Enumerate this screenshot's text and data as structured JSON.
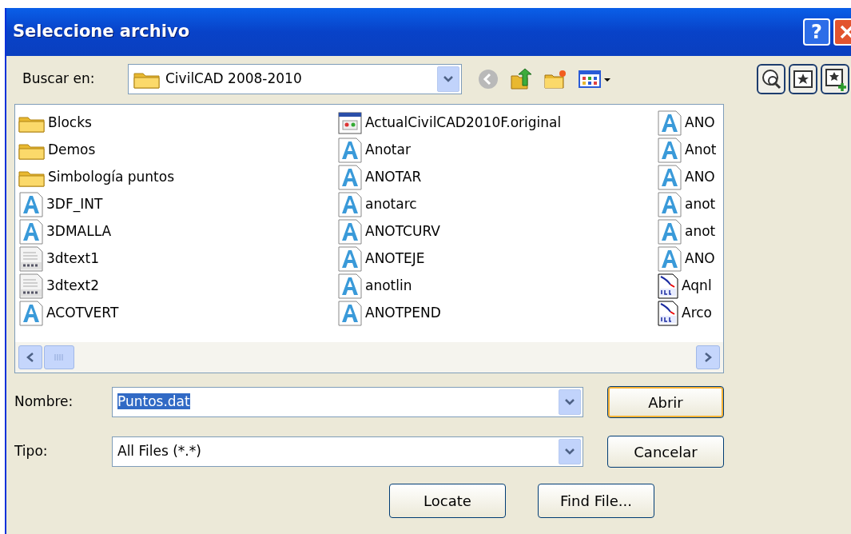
{
  "window": {
    "title": "Seleccione archivo",
    "help": "?"
  },
  "look_in": {
    "label": "Buscar en:",
    "value": "CivilCAD 2008-2010"
  },
  "toolbar": {
    "back_disabled": true
  },
  "file_list": {
    "columns": [
      [
        {
          "kind": "folder",
          "name": "Blocks"
        },
        {
          "kind": "folder",
          "name": "Demos"
        },
        {
          "kind": "folder",
          "name": "Simbología puntos"
        },
        {
          "kind": "font",
          "name": "3DF_INT"
        },
        {
          "kind": "font",
          "name": "3DMALLA"
        },
        {
          "kind": "shx",
          "name": "3dtext1"
        },
        {
          "kind": "shx",
          "name": "3dtext2"
        },
        {
          "kind": "font",
          "name": "ACOTVERT"
        }
      ],
      [
        {
          "kind": "app",
          "name": "ActualCivilCAD2010F.original"
        },
        {
          "kind": "font",
          "name": "Anotar"
        },
        {
          "kind": "font",
          "name": "ANOTAR"
        },
        {
          "kind": "font",
          "name": "anotarc"
        },
        {
          "kind": "font",
          "name": "ANOTCURV"
        },
        {
          "kind": "font",
          "name": "ANOTEJE"
        },
        {
          "kind": "font",
          "name": "anotlin"
        },
        {
          "kind": "font",
          "name": "ANOTPEND"
        }
      ],
      [
        {
          "kind": "font",
          "name": "ANO"
        },
        {
          "kind": "font",
          "name": "Anot"
        },
        {
          "kind": "font",
          "name": "ANO"
        },
        {
          "kind": "font",
          "name": "anot"
        },
        {
          "kind": "font",
          "name": "anot"
        },
        {
          "kind": "font",
          "name": "ANO"
        },
        {
          "kind": "slb",
          "name": "Aqnl"
        },
        {
          "kind": "slb",
          "name": "Arco"
        }
      ]
    ]
  },
  "file_name": {
    "label": "Nombre:",
    "value": "Puntos.dat",
    "highlighted": true
  },
  "file_type": {
    "label": "Tipo:",
    "value": "All Files (*.*)"
  },
  "buttons": [
    {
      "label": "Abrir",
      "default": true
    },
    {
      "label": "Cancelar",
      "default": false
    }
  ],
  "extra_buttons": [
    "Locate",
    "Find File..."
  ]
}
